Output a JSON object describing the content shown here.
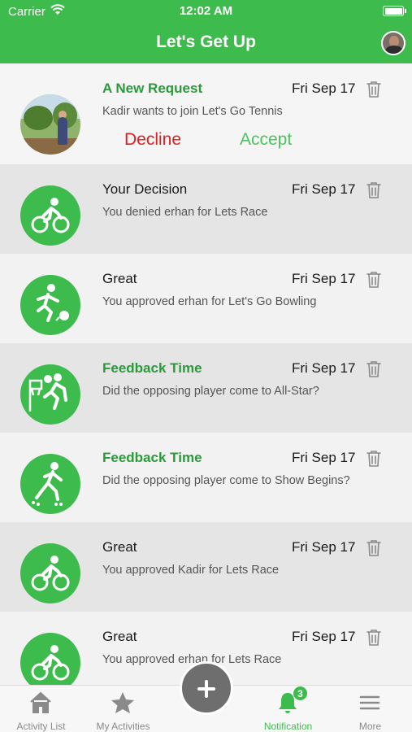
{
  "status_bar": {
    "carrier": "Carrier",
    "time": "12:02 AM"
  },
  "header": {
    "title": "Let's Get Up"
  },
  "request": {
    "heading": "A New Request",
    "date": "Fri Sep 17",
    "message": "Kadir wants to join Let's Go Tennis",
    "decline_label": "Decline",
    "accept_label": "Accept"
  },
  "notifications": [
    {
      "heading": "Your Decision",
      "date": "Fri Sep 17",
      "message": "You denied erhan for Lets Race",
      "icon": "cycling-icon",
      "highlight": false
    },
    {
      "heading": "Great",
      "date": "Fri Sep 17",
      "message": "You approved erhan for Let's Go Bowling",
      "icon": "bowling-icon",
      "highlight": false
    },
    {
      "heading": "Feedback Time",
      "date": "Fri Sep 17",
      "message": "Did the opposing player come to All-Star?",
      "icon": "basketball-icon",
      "highlight": true
    },
    {
      "heading": "Feedback Time",
      "date": "Fri Sep 17",
      "message": "Did the opposing player come to Show Begins?",
      "icon": "rollerblade-icon",
      "highlight": true
    },
    {
      "heading": "Great",
      "date": "Fri Sep 17",
      "message": "You approved Kadir for Lets Race",
      "icon": "cycling-icon",
      "highlight": false
    },
    {
      "heading": "Great",
      "date": "Fri Sep 17",
      "message": "You approved erhan for Lets Race",
      "icon": "cycling-icon",
      "highlight": false
    }
  ],
  "tabs": [
    {
      "label": "Activity List",
      "icon": "home-icon"
    },
    {
      "label": "My Activities",
      "icon": "star-icon"
    },
    {
      "label": "Notification",
      "icon": "bell-icon",
      "badge": "3",
      "active": true
    },
    {
      "label": "More",
      "icon": "menu-icon"
    }
  ],
  "colors": {
    "brand": "#3dbb4d",
    "decline": "#e02020",
    "accept": "#4cc35c"
  }
}
